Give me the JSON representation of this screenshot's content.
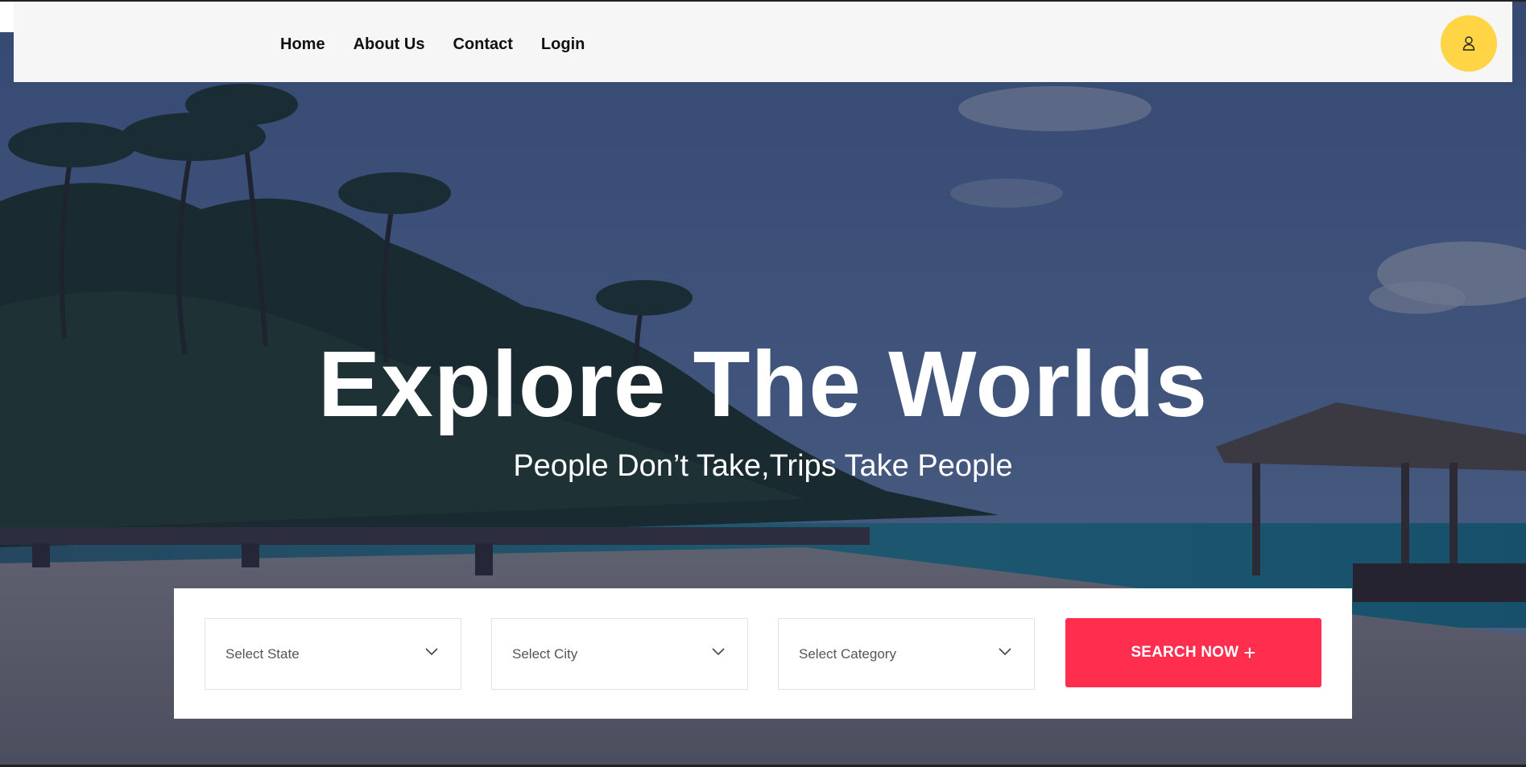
{
  "nav": {
    "items": [
      {
        "label": "Home"
      },
      {
        "label": "About Us"
      },
      {
        "label": "Contact"
      },
      {
        "label": "Login"
      }
    ],
    "user_icon": "user-icon",
    "accent_color": "#ffd546"
  },
  "hero": {
    "title": "Explore The Worlds",
    "subtitle": "People Don’t Take,Trips Take People"
  },
  "search": {
    "state_placeholder": "Select State",
    "city_placeholder": "Select City",
    "category_placeholder": "Select Category",
    "button_label": "SEARCH NOW",
    "button_icon": "plus-icon",
    "dropdown_icon": "chevron-down-icon",
    "button_color": "#ff2e4f"
  }
}
